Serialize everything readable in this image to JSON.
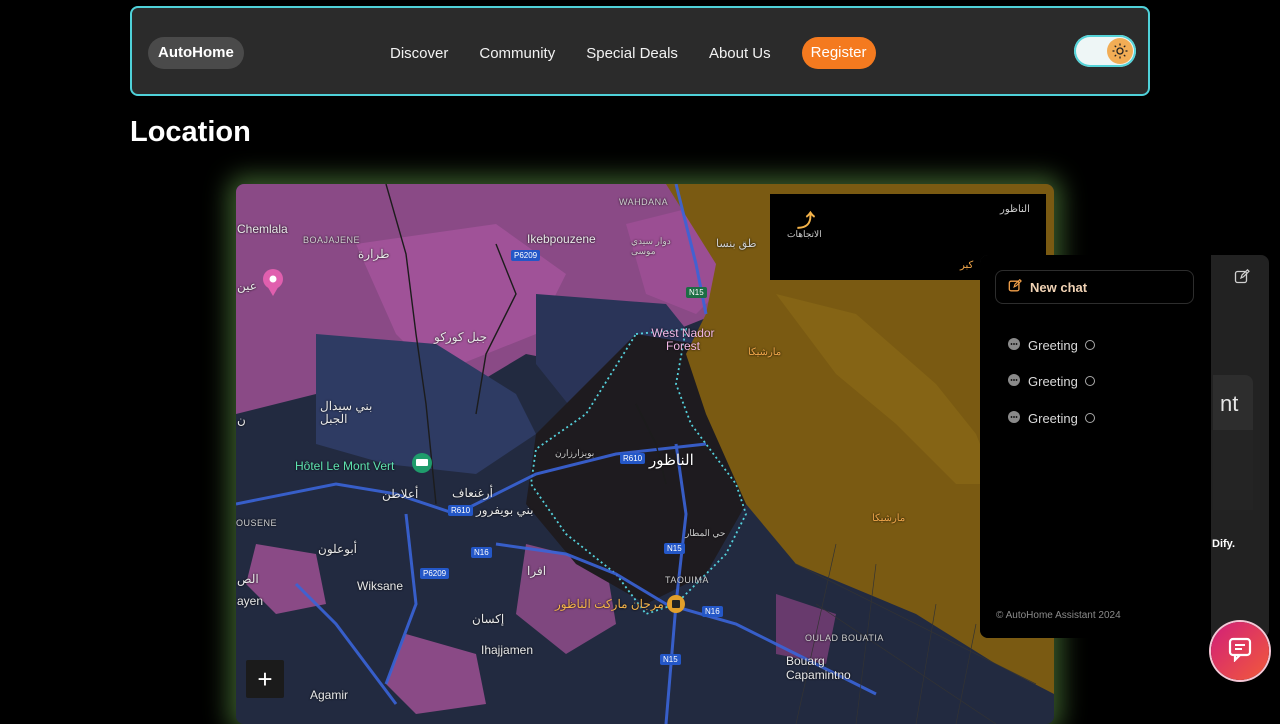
{
  "header": {
    "logo": "AutoHome",
    "nav": [
      "Discover",
      "Community",
      "Special Deals",
      "About Us"
    ],
    "register": "Register",
    "theme_icon": "sun-icon"
  },
  "page": {
    "title": "Location"
  },
  "map": {
    "labels": {
      "chemlala": "Chemlala",
      "boajajene": "BOAJAJENE",
      "tarara": "طرارة",
      "ikebpouzene": "Ikebpouzene",
      "wahdana": "WAHDANA",
      "dwar": "دوار سيدي موسى",
      "jbel_kourkou": "جبل كوركو",
      "west_nador": "West Nador Forest",
      "beni_sidal": "بني سيدال الجبل",
      "hotel": "Hôtel Le Mont Vert",
      "aatlaten": "أعلاطن",
      "arghnaf": "أرغنعاف",
      "beni_bouifrour": "بني بويفرور",
      "nador": "الناظور",
      "bouyzarzaren": "بويزارزارن",
      "ousene": "OUSENE",
      "abouaghloune": "أبوعلون",
      "wiksane": "Wiksane",
      "ayen": "ayen",
      "asab": "الص",
      "ihjjamen_ar": "إكسان",
      "ifra": "افرا",
      "hay_matar": "حي المطار",
      "taouima": "TAOUIMA",
      "marjane": "مرجان ماركت الناظور",
      "ihajjamen": "Ihajjamen",
      "agamir": "Agamir",
      "oulad_bouatia": "OULAD BOUATIA",
      "bouarg": "Bouarg Capamintno",
      "marchica1": "مارشيكا",
      "marchica2": "مارشيكا",
      "n_edge": "ن",
      "ain": "عين",
      "info_title": "الناظور",
      "info_dir": "الاتجاهات",
      "info_sub": "كبر",
      "beni_ensar_partial": "طق بنسا"
    },
    "roads": [
      "P6209",
      "N15",
      "R610",
      "R610",
      "N16",
      "P6209",
      "N15",
      "N16",
      "N15"
    ],
    "zoom_in": "+"
  },
  "chat": {
    "new_chat": "New chat",
    "conversations": [
      "Greeting",
      "Greeting",
      "Greeting"
    ],
    "copyright": "© AutoHome Assistant 2024",
    "partial_title": "nt",
    "dify": "Dify."
  }
}
